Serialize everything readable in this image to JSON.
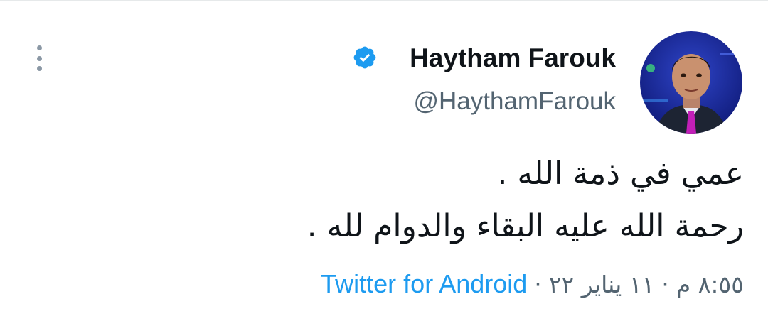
{
  "tweet": {
    "author": {
      "display_name": "Haytham Farouk",
      "handle": "@HaythamFarouk",
      "verified": true,
      "verified_icon": "verified-badge-icon",
      "avatar_icon": "profile-photo"
    },
    "text_lines": [
      "عمي في ذمة الله .",
      "رحمة الله عليه  البقاء والدوام لله ."
    ],
    "timestamp": "٨:٥٥ م",
    "date": "١١ يناير ٢٢",
    "separator": "·",
    "source": "Twitter for Android",
    "menu_icon": "more-vertical-icon"
  },
  "colors": {
    "background": "#ffffff",
    "text_primary": "#0f1419",
    "text_secondary": "#536471",
    "accent": "#1d9bf0",
    "verified": "#1d9bf0"
  }
}
